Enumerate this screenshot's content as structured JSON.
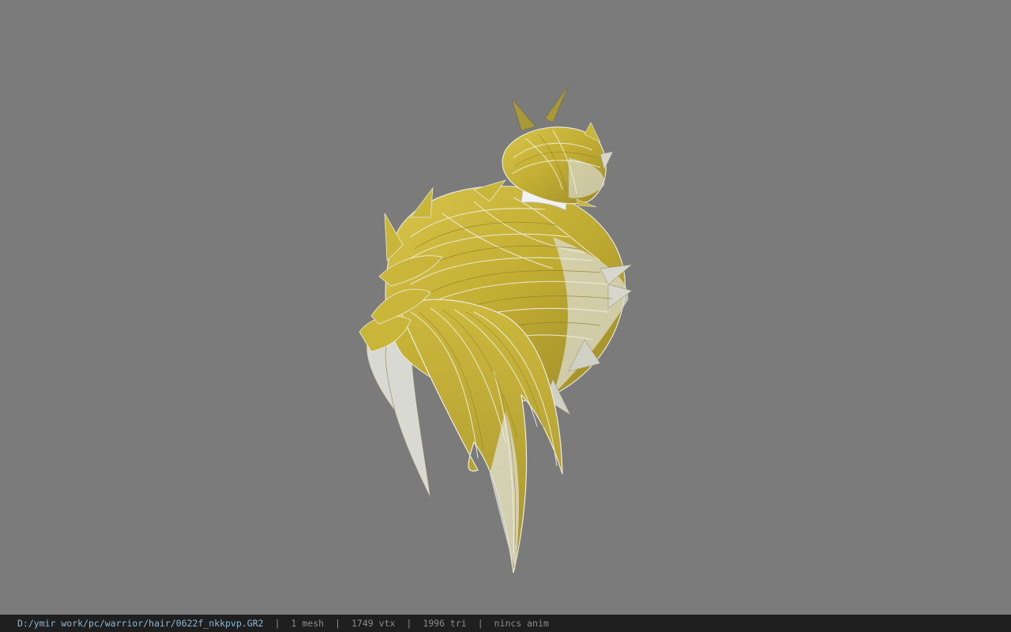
{
  "viewer": {
    "background_color": "#7b7b7b",
    "model_colors": {
      "hair_yellow": "#c9b53a",
      "hair_dark": "#8f7f23",
      "hair_highlight": "#e8e8e0",
      "hair_shadow": "#6e6a4a",
      "band_white": "#f2f2f2"
    }
  },
  "status": {
    "file_path": "D:/ymir work/pc/warrior/hair/0622f_nkkpvp.GR2",
    "mesh": "1 mesh",
    "vertices": "1749 vtx",
    "triangles": "1996 tri",
    "animation": "nincs anim",
    "separator": "|"
  }
}
